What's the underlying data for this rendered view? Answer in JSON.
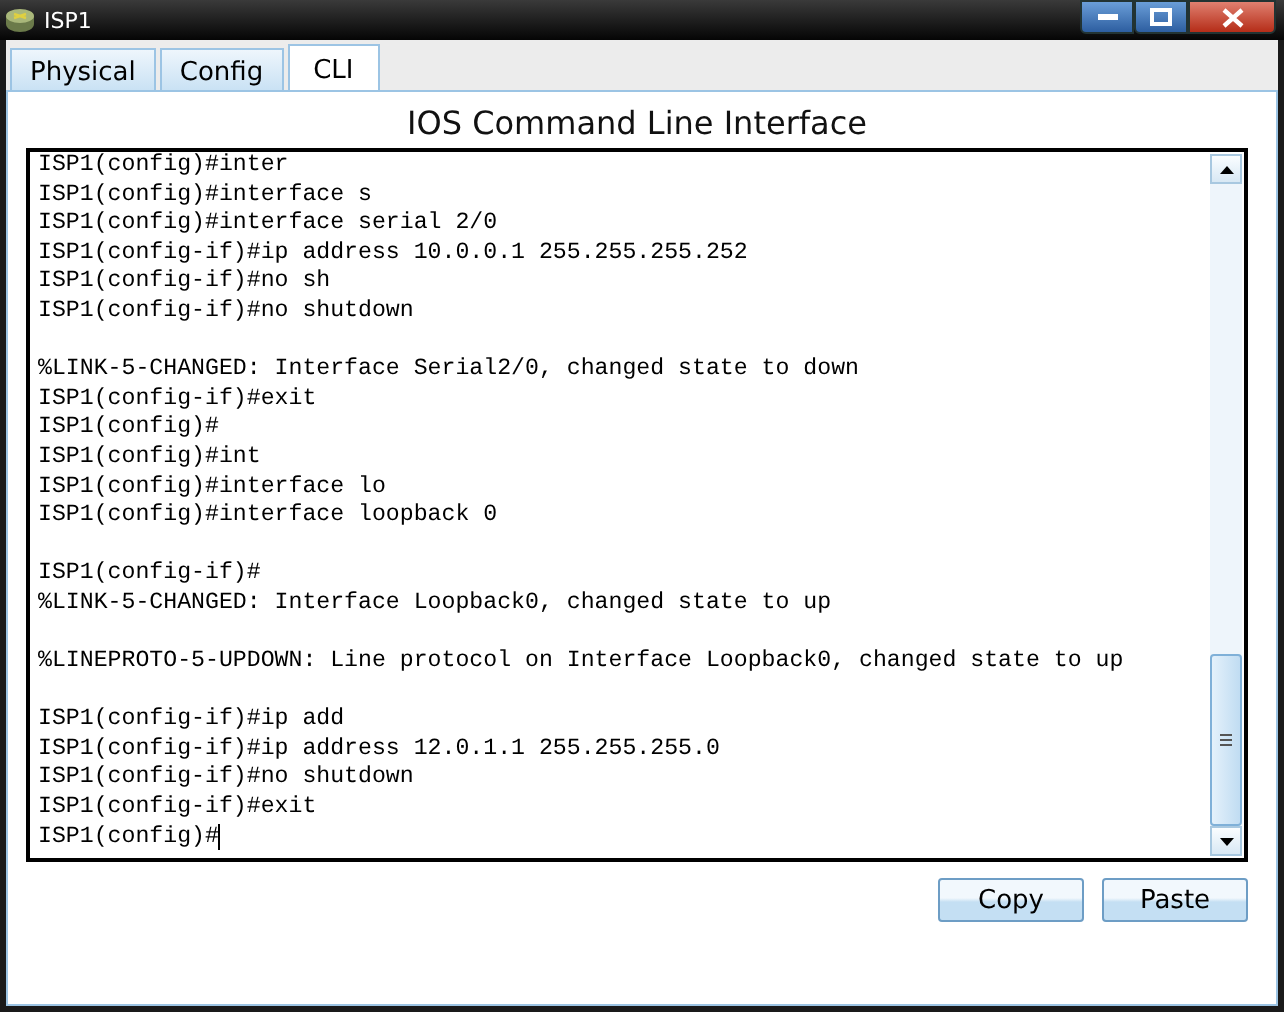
{
  "window": {
    "title": "ISP1"
  },
  "tabs": [
    {
      "label": "Physical",
      "selected": false
    },
    {
      "label": "Config",
      "selected": false
    },
    {
      "label": "CLI",
      "selected": true
    }
  ],
  "heading": "IOS Command Line Interface",
  "terminal": {
    "cursor": true,
    "lines": [
      {
        "kind": "line",
        "text": "ISP1(config)#inter"
      },
      {
        "kind": "line",
        "text": "ISP1(config)#interface s"
      },
      {
        "kind": "line",
        "text": "ISP1(config)#interface serial 2/0"
      },
      {
        "kind": "line",
        "text": "ISP1(config-if)#ip address 10.0.0.1 255.255.255.252"
      },
      {
        "kind": "line",
        "text": "ISP1(config-if)#no sh"
      },
      {
        "kind": "line",
        "text": "ISP1(config-if)#no shutdown"
      },
      {
        "kind": "blank"
      },
      {
        "kind": "line",
        "text": "%LINK-5-CHANGED: Interface Serial2/0, changed state to down"
      },
      {
        "kind": "line",
        "text": "ISP1(config-if)#exit"
      },
      {
        "kind": "line",
        "text": "ISP1(config)#"
      },
      {
        "kind": "line",
        "text": "ISP1(config)#int"
      },
      {
        "kind": "line",
        "text": "ISP1(config)#interface lo"
      },
      {
        "kind": "line",
        "text": "ISP1(config)#interface loopback 0"
      },
      {
        "kind": "blank"
      },
      {
        "kind": "line",
        "text": "ISP1(config-if)#"
      },
      {
        "kind": "line",
        "text": "%LINK-5-CHANGED: Interface Loopback0, changed state to up"
      },
      {
        "kind": "blank"
      },
      {
        "kind": "line",
        "text": "%LINEPROTO-5-UPDOWN: Line protocol on Interface Loopback0, changed state to up"
      },
      {
        "kind": "blank"
      },
      {
        "kind": "line",
        "text": "ISP1(config-if)#ip add"
      },
      {
        "kind": "line",
        "text": "ISP1(config-if)#ip address 12.0.1.1 255.255.255.0"
      },
      {
        "kind": "line",
        "text": "ISP1(config-if)#no shutdown"
      },
      {
        "kind": "line",
        "text": "ISP1(config-if)#exit"
      },
      {
        "kind": "line",
        "text": "ISP1(config)#"
      }
    ]
  },
  "buttons": [
    "Copy",
    "Paste"
  ]
}
